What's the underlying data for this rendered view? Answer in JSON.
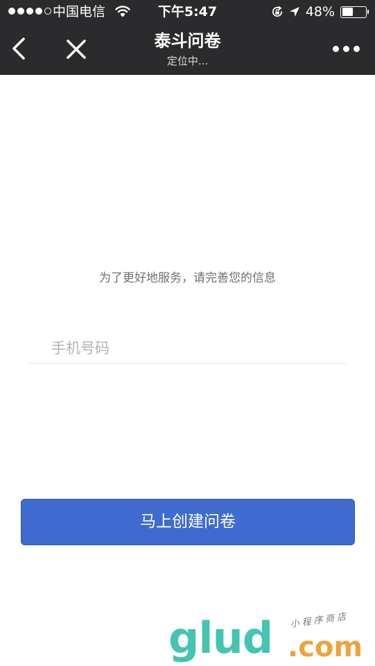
{
  "status_bar": {
    "carrier": "中国电信",
    "time": "下午5:47",
    "battery_text": "48%",
    "battery_level": 0.48,
    "signal_filled": 4,
    "signal_total": 5
  },
  "nav": {
    "title": "泰斗问卷",
    "subtitle": "定位中..."
  },
  "form": {
    "prompt": "为了更好地服务，请完善您的信息",
    "phone_placeholder": "手机号码",
    "phone_value": "",
    "submit_label": "马上创建问卷"
  },
  "watermark": {
    "main": "glud",
    "tld": ".com",
    "tagline": "小程序商店"
  },
  "colors": {
    "header_bg": "#2b2b2d",
    "primary_button": "#3f6bd0",
    "prompt_text": "#707070",
    "placeholder": "#b3b3b3",
    "watermark_teal": "#45c4b0",
    "watermark_orange": "#f0a23a"
  },
  "icons": {
    "back": "chevron-left-icon",
    "close": "close-icon",
    "more": "more-dots-icon",
    "wifi": "wifi-icon",
    "rotation_lock": "rotation-lock-icon",
    "location": "location-arrow-icon",
    "battery": "battery-icon"
  }
}
